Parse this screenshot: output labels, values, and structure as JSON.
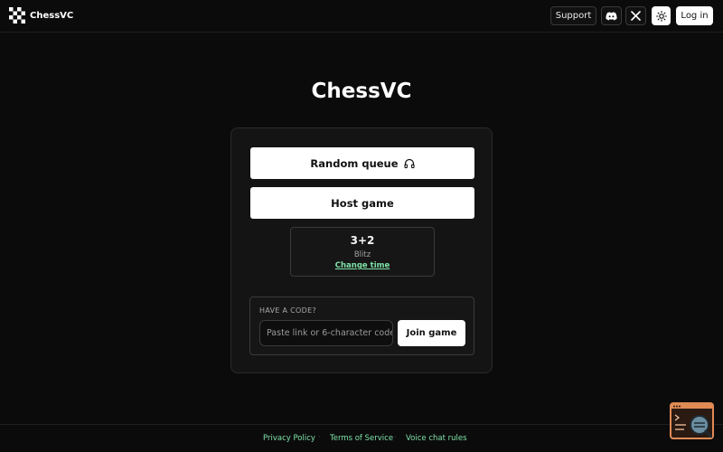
{
  "header": {
    "brand": "ChessVC",
    "support_label": "Support",
    "login_label": "Log in",
    "icons": [
      "chessboard-logo-icon",
      "discord-icon",
      "x-icon",
      "sun-icon"
    ]
  },
  "main": {
    "title": "ChessVC",
    "random_queue_label": "Random queue",
    "random_queue_icon": "headphones-icon",
    "host_game_label": "Host game",
    "time_control": {
      "value": "3+2",
      "mode": "Blitz",
      "change_label": "Change time"
    },
    "code": {
      "label": "HAVE A CODE?",
      "placeholder": "Paste link or 6-character code",
      "join_label": "Join game"
    }
  },
  "footer": {
    "links": [
      "Privacy Policy",
      "Terms of Service",
      "Voice chat rules"
    ],
    "separator": "·"
  },
  "colors": {
    "background": "#0b0b0b",
    "card": "#141414",
    "accent_link": "#7fe3a8",
    "button": "#ffffff",
    "widget_accent": "#e08a55"
  }
}
